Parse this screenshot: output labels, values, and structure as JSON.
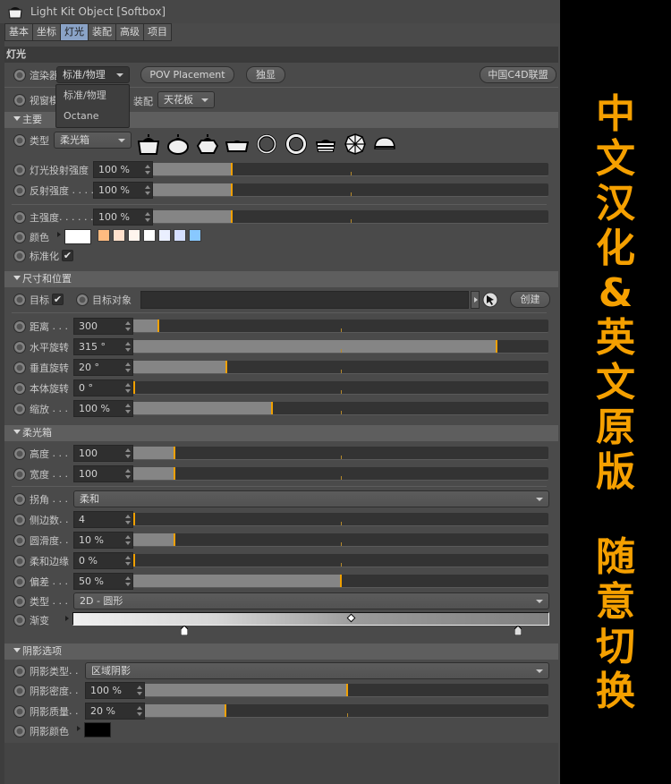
{
  "window": {
    "title": "Light Kit Object [Softbox]",
    "icon": "softbox-lamp-icon"
  },
  "tabs": [
    {
      "label": "基本",
      "active": false
    },
    {
      "label": "坐标",
      "active": false
    },
    {
      "label": "灯光",
      "active": true
    },
    {
      "label": "装配",
      "active": false
    },
    {
      "label": "高级",
      "active": false
    },
    {
      "label": "项目",
      "active": false
    }
  ],
  "section_title": "灯光",
  "renderer": {
    "label": "渲染器",
    "value": "标准/物理",
    "options": [
      "标准/物理",
      "Octane"
    ],
    "pov_button": "POV Placement",
    "solo_button": "独显",
    "c4d_button": "中国C4D联盟"
  },
  "viewport": {
    "label": "视窗模式",
    "rig_label": "装配",
    "rig_value": "天花板"
  },
  "main_group": {
    "title": "主要",
    "type_label": "类型",
    "type_value": "柔光箱",
    "lamp_types": [
      "softbox-square-icon",
      "dome-lamp-icon",
      "octa-lamp-icon",
      "strip-softbox-icon",
      "ring-light-icon",
      "ring-light-thick-icon",
      "grid-softbox-icon",
      "umbrella-icon",
      "half-dome-icon"
    ],
    "sliders": [
      {
        "label": "灯光投射强度",
        "value": "100 %",
        "fraction": 0.2
      },
      {
        "label": "反射强度",
        "value": "100 %",
        "fraction": 0.2
      },
      {
        "label": "主强度",
        "value": "100 %",
        "fraction": 0.2
      }
    ],
    "color_label": "颜色",
    "color_value": "#ffffff",
    "swatches": [
      "#ffbb80",
      "#ffe1cc",
      "#fff5ee",
      "#ffffff",
      "#eaefff",
      "#d5dfff",
      "#88c8ff"
    ],
    "normalize_label": "标准化",
    "normalize_checked": true
  },
  "size_group": {
    "title": "尺寸和位置",
    "target_label": "目标",
    "target_checked": true,
    "target_object_label": "目标对象",
    "target_object_value": "",
    "create_button": "创建",
    "sliders": [
      {
        "label": "距离",
        "value": "300",
        "fraction": 0.06
      },
      {
        "label": "水平旋转",
        "value": "315 °",
        "fraction": 0.875
      },
      {
        "label": "垂直旋转",
        "value": "20 °",
        "fraction": 0.225
      },
      {
        "label": "本体旋转",
        "value": "0 °",
        "fraction": 0.0
      },
      {
        "label": "缩放",
        "value": "100 %",
        "fraction": 0.333
      }
    ]
  },
  "softbox_group": {
    "title": "柔光箱",
    "sliders_a": [
      {
        "label": "高度",
        "value": "100",
        "fraction": 0.1
      },
      {
        "label": "宽度",
        "value": "100",
        "fraction": 0.1
      }
    ],
    "corner_label": "拐角",
    "corner_value": "柔和",
    "sliders_b": [
      {
        "label": "侧边数",
        "value": "4",
        "fraction": 0.0
      },
      {
        "label": "圆滑度",
        "value": "10 %",
        "fraction": 0.1
      },
      {
        "label": "柔和边缘",
        "value": "0 %",
        "fraction": 0.0
      },
      {
        "label": "偏差",
        "value": "50 %",
        "fraction": 0.5
      }
    ],
    "shape_label": "类型",
    "shape_value": "2D - 圆形",
    "gradient_label": "渐变",
    "gradient_stops": [
      {
        "color": "#ffffff",
        "position": 0.235
      },
      {
        "color": "#808080",
        "position": 0.935
      }
    ],
    "gradient_mid": 0.585
  },
  "shadow_group": {
    "title": "阴影选项",
    "type_label": "阴影类型",
    "type_value": "区域阴影",
    "sliders": [
      {
        "label": "阴影密度",
        "value": "100 %",
        "fraction": 0.5
      },
      {
        "label": "阴影质量",
        "value": "20 %",
        "fraction": 0.2
      }
    ],
    "color_label": "阴影颜色",
    "color_value": "#000000"
  },
  "promo_text": [
    "中",
    "文",
    "汉",
    "化",
    "&",
    "英",
    "文",
    "原",
    "版",
    "",
    "随",
    "意",
    "切",
    "换"
  ],
  "accent_color": "#f5a000"
}
